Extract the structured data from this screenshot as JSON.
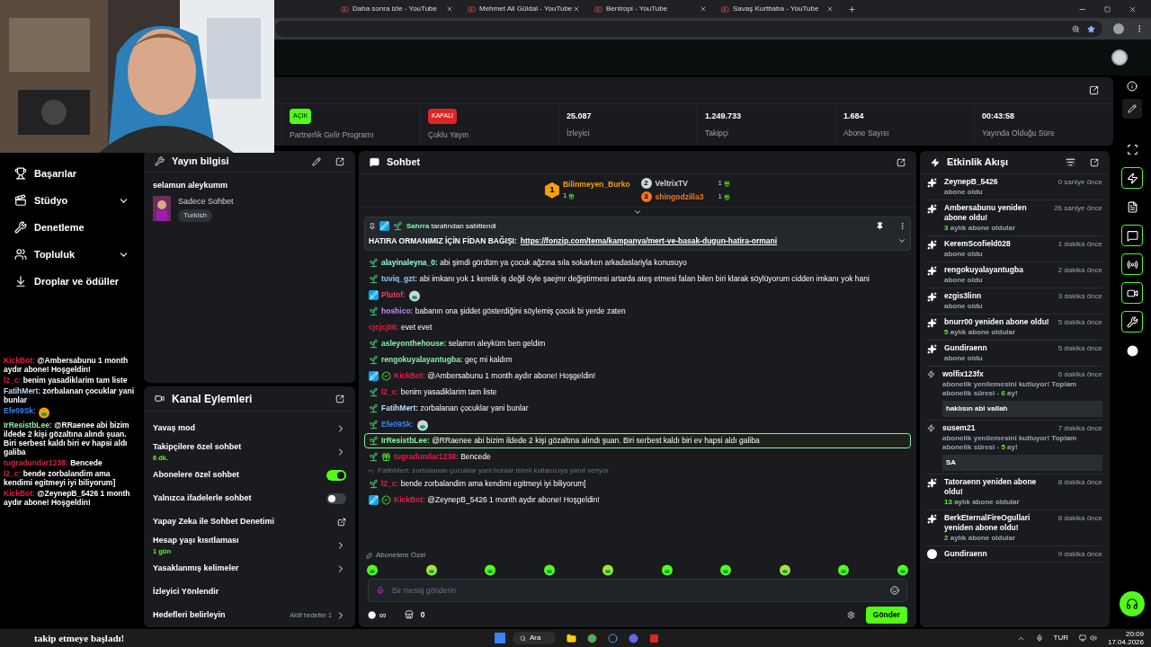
{
  "browser": {
    "tabs": [
      {
        "title": "Daha sonra izle - YouTube",
        "selected": false
      },
      {
        "title": "Mehmet Ali Güldal - YouTube",
        "selected": false
      },
      {
        "title": "Bentropi - YouTube",
        "selected": false
      },
      {
        "title": "Savaş Kurtbaba - YouTube",
        "selected": false
      }
    ]
  },
  "stats": [
    {
      "kind": "toggle",
      "badge": "AÇIK",
      "on": true,
      "label": "Partnerlik Gelir Programı"
    },
    {
      "kind": "toggle",
      "badge": "KAPALI",
      "on": false,
      "label": "Çoklu Yayın"
    },
    {
      "kind": "number",
      "value": "25.087",
      "label": "İzleyici"
    },
    {
      "kind": "number",
      "value": "1.249.733",
      "label": "Takipçi"
    },
    {
      "kind": "number",
      "value": "1.684",
      "label": "Abone Sayısı"
    },
    {
      "kind": "number",
      "value": "00:43:58",
      "label": "Yayında Olduğu Süre"
    }
  ],
  "nav": [
    {
      "label": "Başarılar",
      "expandable": false
    },
    {
      "label": "Stüdyo",
      "expandable": true
    },
    {
      "label": "Denetleme",
      "expandable": false
    },
    {
      "label": "Topluluk",
      "expandable": true
    },
    {
      "label": "Droplar ve ödüller",
      "expandable": false
    }
  ],
  "overlay_chat": [
    {
      "user": "KickBot:",
      "color": "#e11d48",
      "kind": "text",
      "text": "@Ambersabunu 1 month aydır abone! Hoşgeldin!"
    },
    {
      "user": "l2_c:",
      "color": "#e11d48",
      "kind": "text",
      "text": "benim yasadiklarim tam liste"
    },
    {
      "user": "FatihMert:",
      "color": "#bfdbfe",
      "kind": "text",
      "text": "zorbalanan çocuklar yani bunlar"
    },
    {
      "user": "Efe09Sk:",
      "color": "#3b82f6",
      "kind": "emote"
    },
    {
      "user": "IrResistbLee:",
      "color": "#86efac",
      "kind": "text",
      "text": "@RRaenee abi bizim ildede 2 kişi gözaltına alındı şuan. Biri serbest kaldı biri ev hapsi aldı galiba"
    },
    {
      "user": "tugradundar1238:",
      "color": "#e11d48",
      "kind": "text",
      "text": "Bencede"
    },
    {
      "user": "l2_c:",
      "color": "#e11d48",
      "kind": "text",
      "text": "bende zorbalandim ama kendimi egitmeyi iyi biliyorum]"
    },
    {
      "user": "KickBot:",
      "color": "#e11d48",
      "kind": "text",
      "text": "@ZeynepB_5426 1 month aydır abone! Hoşgeldin!"
    }
  ],
  "alert": {
    "text": "takip etmeye başladı!"
  },
  "stream_info": {
    "title": "Yayın bilgisi",
    "stream_title": "selamun aleykumm",
    "category": "Sadece Sohbet",
    "tag": "Turkish"
  },
  "channel_actions": {
    "title": "Kanal Eylemleri",
    "items": [
      {
        "kind": "nav",
        "label": "Yavaş mod"
      },
      {
        "kind": "nav",
        "label": "Takipçilere özel sohbet",
        "sub": "6 dk."
      },
      {
        "kind": "toggle",
        "label": "Abonelere özel sohbet",
        "on": true
      },
      {
        "kind": "toggle",
        "label": "Yalnızca ifadelerle sohbet",
        "on": false
      },
      {
        "kind": "external",
        "label": "Yapay Zeka ile Sohbet Denetimi"
      },
      {
        "kind": "nav",
        "label": "Hesap yaşı kısıtlaması",
        "sub": "1 gün"
      },
      {
        "kind": "nav",
        "label": "Yasaklanmış kelimeler"
      },
      {
        "kind": "plain",
        "label": "İzleyici Yönlendir"
      },
      {
        "kind": "nav",
        "label": "Hedefleri belirleyin",
        "extra": "Aktif hedefler",
        "extra_count": "1"
      }
    ]
  },
  "chat": {
    "title": "Sohbet",
    "leaderboard": [
      {
        "rank": "1",
        "name": "Bilinmeyen_Burko",
        "count": "1",
        "color": "#f59e0b"
      },
      {
        "rank": "2",
        "name": "VeltrixTV",
        "count": "1",
        "color": "#d1d5db"
      },
      {
        "rank": "3",
        "name": "shingodzilla3",
        "count": "1",
        "color": "#f97316"
      }
    ],
    "pinned": {
      "by": "Sahrra",
      "by_suffix": "tarafından sabitlendi",
      "text": "HATIRA ORMANIMIZ İÇİN FİDAN BAĞIŞI:",
      "link": "https://fonzip.com/tema/kampanya/mert-ve-basak-dugun-hatira-ormani"
    },
    "messages": [
      {
        "user": "alayinaleyna_0:",
        "color": "#99f6e4",
        "kind": "text",
        "badges": [
          {
            "kind": "sub"
          }
        ],
        "highlighted": false,
        "text": "abi şimdi gördüm ya çocuk ağzına sıla sokarken arkadaslariyla konusuyo"
      },
      {
        "user": "tuviq_gzt:",
        "color": "#93c5fd",
        "kind": "text",
        "badges": [
          {
            "kind": "sub"
          }
        ],
        "highlighted": false,
        "text": "abi imkanı yok 1 kerelik iş değil öyle şaejmr değiştirmesi artarda ateş etmesi falan bilen biri klarak söylüyorum cidden imkanı yok hani"
      },
      {
        "user": "Plutof:",
        "color": "#f43f5e",
        "kind": "emote",
        "badges": [
          {
            "kind": "mod"
          }
        ],
        "highlighted": false
      },
      {
        "user": "hoshico:",
        "color": "#c084fc",
        "kind": "text",
        "badges": [
          {
            "kind": "sub"
          }
        ],
        "highlighted": false,
        "text": "babanın ona şiddet gösterdiğini söylemiş çocuk bi yerde zaten"
      },
      {
        "user": "cjcjcj06:",
        "color": "#e11d48",
        "kind": "text",
        "highlighted": false,
        "text": "evet evet"
      },
      {
        "user": "asleyonthehouse:",
        "color": "#86efac",
        "kind": "text",
        "badges": [
          {
            "kind": "sub"
          }
        ],
        "highlighted": false,
        "text": "selamın aleyküm ben geldim"
      },
      {
        "user": "rengokuyalayantugba:",
        "color": "#86efac",
        "kind": "text",
        "badges": [
          {
            "kind": "sub"
          }
        ],
        "highlighted": false,
        "text": "geç mi kaldım"
      },
      {
        "user": "KickBot:",
        "color": "#e11d48",
        "kind": "text",
        "badges": [
          {
            "kind": "mod"
          },
          {
            "kind": "verified"
          }
        ],
        "highlighted": false,
        "text": "@Ambersabunu 1 month aydır abone! Hoşgeldin!"
      },
      {
        "user": "l2_c:",
        "color": "#e11d48",
        "kind": "text",
        "badges": [
          {
            "kind": "sub"
          }
        ],
        "highlighted": false,
        "text": "benim yasadiklarim tam liste"
      },
      {
        "user": "FatihMert:",
        "color": "#bfdbfe",
        "kind": "text",
        "badges": [
          {
            "kind": "sub"
          }
        ],
        "highlighted": false,
        "text": "zorbalanan çocuklar yani bunlar"
      },
      {
        "user": "Efe09Sk:",
        "color": "#3b82f6",
        "kind": "emote",
        "badges": [
          {
            "kind": "sub"
          }
        ],
        "highlighted": false
      },
      {
        "user": "IrResistbLee:",
        "color": "#86efac",
        "kind": "text",
        "badges": [
          {
            "kind": "sub"
          }
        ],
        "highlighted": true,
        "text": "@RRaenee abi bizim ildede 2 kişi gözaltına alındı şuan. Biri serbest kaldı biri ev hapsi aldı galiba"
      },
      {
        "user": "tugradundar1238:",
        "color": "#e11d48",
        "kind": "text",
        "badges": [
          {
            "kind": "sub"
          },
          {
            "kind": "gift"
          }
        ],
        "highlighted": false,
        "text": "Bencede"
      },
      {
        "user": "l2_c:",
        "color": "#e11d48",
        "kind": "text",
        "badges": [
          {
            "kind": "sub"
          }
        ],
        "highlighted": false,
        "reply": "FatihMert: zorbalanan çocuklar yani bunlar isimli kullanıcıya yanıt veriyor",
        "text": "bende zorbalandim ama kendimi egitmeyi iyi biliyorum]"
      },
      {
        "user": "KickBot:",
        "color": "#e11d48",
        "kind": "text",
        "badges": [
          {
            "kind": "mod"
          },
          {
            "kind": "verified"
          }
        ],
        "highlighted": false,
        "text": "@ZeynepB_5426 1 month aydır abone! Hoşgeldin!"
      }
    ],
    "emote_section": "Abonelere Özel",
    "input": {
      "placeholder": "Bir mesaj gönderin"
    },
    "kicks": "∞",
    "store_count": "0",
    "send": "Gönder"
  },
  "events": {
    "title": "Etkinlik Akışı",
    "items": [
      {
        "kind": "sub",
        "title": "ZeynepB_5426",
        "time": "0 saniye önce",
        "parts": [
          {
            "text": "abone oldu",
            "highlight": false
          }
        ]
      },
      {
        "kind": "sub",
        "title": "Ambersabunu yeniden abone oldu!",
        "time": "26 saniye önce",
        "parts": [
          {
            "text": "3",
            "highlight": true
          },
          {
            "text": "aylık abone oldular",
            "highlight": false
          }
        ]
      },
      {
        "kind": "sub",
        "title": "KeremScofield028",
        "time": "1 dakika önce",
        "parts": [
          {
            "text": "abone oldu",
            "highlight": false
          }
        ]
      },
      {
        "kind": "sub",
        "title": "rengokuyalayantugba",
        "time": "2 dakika önce",
        "parts": [
          {
            "text": "abone oldu",
            "highlight": false
          }
        ]
      },
      {
        "kind": "sub",
        "title": "ezgis3linn",
        "time": "3 dakika önce",
        "parts": [
          {
            "text": "abone oldu",
            "highlight": false
          }
        ]
      },
      {
        "kind": "sub",
        "title": "bnurr00 yeniden abone oldu!",
        "time": "5 dakika önce",
        "parts": [
          {
            "text": "5",
            "highlight": true
          },
          {
            "text": "aylık abone oldular",
            "highlight": false
          }
        ]
      },
      {
        "kind": "sub",
        "title": "Gundiraenn",
        "time": "5 dakika önce",
        "parts": [
          {
            "text": "abone oldu",
            "highlight": false
          }
        ]
      },
      {
        "kind": "renew",
        "title": "wolfix123fx",
        "time": "6 dakika önce",
        "parts": [
          {
            "text": "abonelik yenilemesini kutluyor! Toplam abonelik süresi -",
            "highlight": false
          },
          {
            "text": "6",
            "highlight": true
          },
          {
            "text": "ay!",
            "highlight": false
          }
        ],
        "message": "haklısın abi vallah"
      },
      {
        "kind": "renew",
        "title": "susem21",
        "time": "7 dakika önce",
        "parts": [
          {
            "text": "abonelik yenilemesini kutluyor! Toplam abonelik süresi -",
            "highlight": false
          },
          {
            "text": "5",
            "highlight": true
          },
          {
            "text": "ay!",
            "highlight": false
          }
        ],
        "message": "SA"
      },
      {
        "kind": "sub",
        "title": "Tatoraenn yeniden abone oldu!",
        "time": "8 dakika önce",
        "parts": [
          {
            "text": "13",
            "highlight": true
          },
          {
            "text": "aylık abone oldular",
            "highlight": false
          }
        ]
      },
      {
        "kind": "sub",
        "title": "BerkEternalFireOgullari yeniden abone oldu!",
        "time": "8 dakika önce",
        "parts": [
          {
            "text": "2",
            "highlight": true
          },
          {
            "text": "aylık abone oldular",
            "highlight": false
          }
        ]
      },
      {
        "kind": "kicks",
        "title": "Gundiraenn",
        "time": "9 dakika önce"
      }
    ]
  },
  "rail": [
    {
      "selected": false
    },
    {
      "selected": true
    },
    {
      "selected": false
    },
    {
      "selected": true
    },
    {
      "selected": true
    },
    {
      "selected": true
    },
    {
      "selected": true
    },
    {
      "selected": false
    }
  ],
  "taskbar": {
    "search": "Ara",
    "lang": "TUR",
    "time": "20:09",
    "date": "17.04.2026"
  }
}
